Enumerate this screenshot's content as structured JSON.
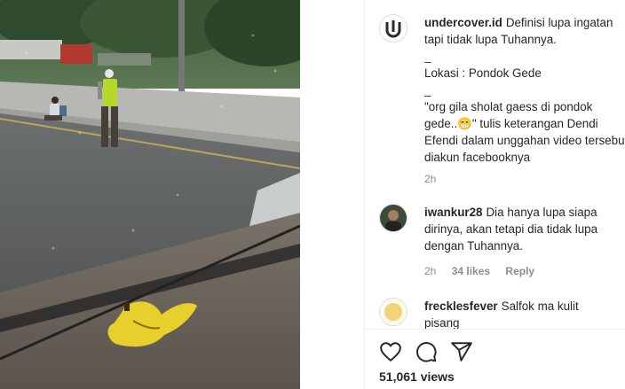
{
  "caption": {
    "username": "undercover.id",
    "line1": "Definisi lupa ingatan",
    "line2": "tapi tidak lupa Tuhannya.",
    "dash": "_",
    "location": "Lokasi : Pondok Gede",
    "dash2": "_",
    "quote_line1": "\"org gila sholat gaess di pondok",
    "quote_line2": "gede..😁\" tulis keterangan Dendi",
    "quote_line3": "Efendi dalam unggahan video tersebut",
    "quote_line4": "diakun facebooknya",
    "time": "2h"
  },
  "comments": [
    {
      "username": "iwankur28",
      "line1": "Dia hanya lupa siapa",
      "line2": "dirinya, akan tetapi dia tidak lupa",
      "line3": "dengan Tuhannya.",
      "time": "2h",
      "likes": "34 likes",
      "reply": "Reply"
    },
    {
      "username": "frecklesfever",
      "line1": "Salfok ma kulit",
      "line2": "pisang"
    }
  ],
  "actions": {
    "like_icon": "heart-icon",
    "comment_icon": "comment-icon",
    "share_icon": "share-icon"
  },
  "views": "51,061 views"
}
